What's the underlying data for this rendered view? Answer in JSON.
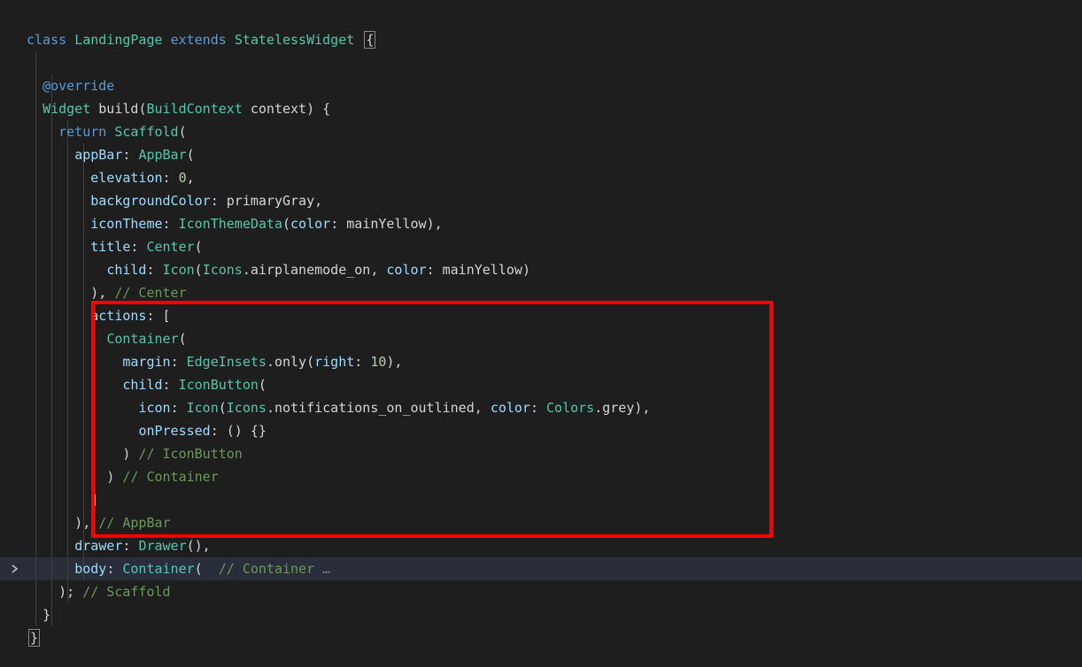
{
  "code": {
    "kw_class": "class",
    "type_landingpage": "LandingPage",
    "kw_extends": "extends",
    "type_statelesswidget": "StatelessWidget",
    "open_brace": "{",
    "annot_override": "@override",
    "type_widget": "Widget",
    "method_build": "build",
    "type_buildcontext": "BuildContext",
    "param_context": "context",
    "kw_return": "return",
    "type_scaffold": "Scaffold",
    "param_appbar": "appBar",
    "type_appbar": "AppBar",
    "param_elevation": "elevation",
    "num_zero": "0",
    "param_backgroundcolor": "backgroundColor",
    "ident_primarygray": "primaryGray",
    "param_icontheme": "iconTheme",
    "type_iconthemedata": "IconThemeData",
    "param_color": "color",
    "ident_mainyellow": "mainYellow",
    "param_title": "title",
    "type_center": "Center",
    "param_child": "child",
    "type_icon": "Icon",
    "ident_icons": "Icons",
    "ident_airplanemode": "airplanemode_on",
    "comment_center": "// Center",
    "param_actions": "actions",
    "type_container": "Container",
    "param_margin": "margin",
    "type_edgeinsets": "EdgeInsets",
    "method_only": "only",
    "param_right": "right",
    "num_ten": "10",
    "type_iconbutton": "IconButton",
    "param_icon": "icon",
    "ident_notifications": "notifications_on_outlined",
    "type_colors": "Colors",
    "ident_grey": "grey",
    "param_onpressed": "onPressed",
    "empty_closure": "() {}",
    "comment_iconbutton": "// IconButton",
    "comment_container": "// Container",
    "comment_appbar": "// AppBar",
    "param_drawer": "drawer",
    "type_drawer": "Drawer",
    "param_body": "body",
    "comment_container2": "// Container",
    "ellipsis": "…",
    "comment_scaffold": "// Scaffold",
    "close_brace": "}"
  },
  "annotation": {
    "highlight_top_line": 13,
    "highlight_bottom_line": 22,
    "current_line": 24
  }
}
